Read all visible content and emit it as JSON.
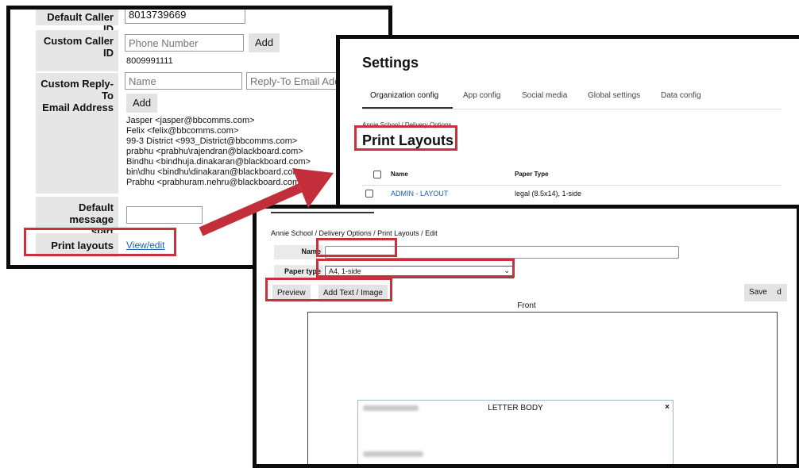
{
  "panel1": {
    "default_caller_id_label": "Default Caller ID",
    "default_caller_id_value": "8013739669",
    "custom_caller_id_label": "Custom Caller ID",
    "phone_placeholder": "Phone Number",
    "add_label": "Add",
    "custom_caller_number": "8009991111",
    "reply_to_label_1": "Custom Reply-To",
    "reply_to_label_2": "Email Address",
    "name_placeholder": "Name",
    "reply_email_placeholder": "Reply-To Email Add",
    "reply_add_label": "Add",
    "reply_to_list": [
      "Jasper <jasper@bbcomms.com>",
      "Felix <felix@bbcomms.com>",
      "99-3 District <993_District@bbcomms.com>",
      "prabhu <prabhu\\rajendran@blackboard.com>",
      "Bindhu <bindhuja.dinakaran@blackboard.com>",
      "bin\\dhu <bindhu\\dinakaran@blackboard.com>",
      "Prabhu <prabhuram.nehru@blackboard.com>"
    ],
    "default_msg_label_1": "Default message",
    "default_msg_label_2": "start",
    "print_layouts_label": "Print layouts",
    "view_edit_link": "View/edit"
  },
  "panel2": {
    "title": "Settings",
    "tabs": [
      "Organization config",
      "App config",
      "Social media",
      "Global settings",
      "Data config"
    ],
    "breadcrumb": "Annie School / Delivery Options",
    "page_title": "Print Layouts",
    "col_name": "Name",
    "col_paper": "Paper Type",
    "rows": [
      {
        "name": "ADMIN - LAYOUT",
        "paper": "legal (8.5x14), 1-side"
      }
    ]
  },
  "panel3": {
    "breadcrumb": "Annie School / Delivery Options / Print Layouts / Edit",
    "name_label": "Name",
    "name_value": "",
    "paper_type_label": "Paper type",
    "paper_type_value": "A4, 1-side",
    "preview_label": "Preview",
    "add_text_image_label": "Add Text / Image",
    "save_label": "Save",
    "front_label": "Front",
    "letter_body_label": "LETTER BODY",
    "close_glyph": "×"
  },
  "colors": {
    "highlight": "#c8323c",
    "arrow": "#c22f3b",
    "link": "#1a5fb4"
  }
}
